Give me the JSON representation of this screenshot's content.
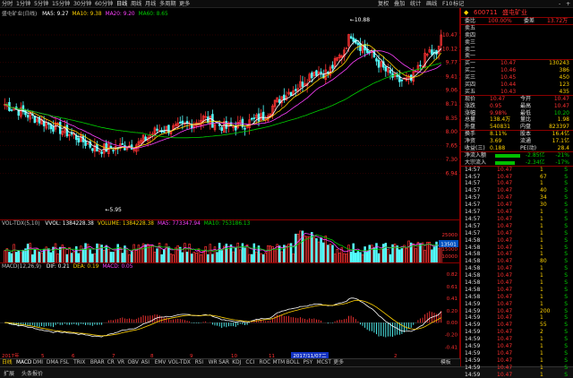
{
  "toolbar": {
    "items": [
      "分时",
      "1分钟",
      "5分钟",
      "15分钟",
      "30分钟",
      "60分钟",
      "日线",
      "周线",
      "月线",
      "多周期",
      "更多"
    ],
    "active_index": 6,
    "right_items": [
      "复权",
      "叠加",
      "统计",
      "画线",
      "F10",
      "标记",
      "-",
      "+"
    ]
  },
  "main": {
    "title": "盛屯矿业(日线)",
    "ma_legend": [
      {
        "label": "MA5: 9.27",
        "color": "#ffffff"
      },
      {
        "label": "MA10: 9.38",
        "color": "#ffd200"
      },
      {
        "label": "MA20: 9.20",
        "color": "#ff40ff"
      },
      {
        "label": "MA60: 8.65",
        "color": "#00d000"
      }
    ],
    "y_labels": [
      "10.47",
      "10.12",
      "9.77",
      "9.41",
      "9.06",
      "8.71",
      "8.35",
      "8.00",
      "7.65",
      "7.30",
      "6.94"
    ],
    "high_label": "10.88",
    "low_label": "5.95"
  },
  "volume": {
    "title": "VOL-TDX(5,10)",
    "legend": [
      {
        "label": "VVOL: 1384228.38",
        "color": "#ffffff"
      },
      {
        "label": "VOLUME: 1384228.38",
        "color": "#ffd200"
      },
      {
        "label": "MA5: 773347.94",
        "color": "#ff40ff"
      },
      {
        "label": "MA10: 753186.13",
        "color": "#00d000"
      }
    ],
    "y_labels": [
      "25000",
      "20000",
      "15000",
      "10000"
    ],
    "unit": "x100",
    "marker": "13501"
  },
  "macd": {
    "title": "MACD(12,26,9)",
    "legend": [
      {
        "label": "DIF: 0.21",
        "color": "#ffffff"
      },
      {
        "label": "DEA: 0.19",
        "color": "#ffd200"
      },
      {
        "label": "MACD: 0.05",
        "color": "#ff40ff"
      }
    ],
    "y_labels": [
      "0.82",
      "0.61",
      "0.41",
      "0.20",
      "0.00",
      "-0.20",
      "-0.41"
    ],
    "date_labels": [
      "2017年",
      "5",
      "6",
      "7",
      "8",
      "9",
      "10",
      "11",
      "12",
      "2"
    ],
    "date_cursor": "2017/11/07二"
  },
  "bottom_tabs": {
    "items": [
      "MACD",
      "DMI",
      "DMA",
      "FSL",
      "TRIX",
      "BRAR",
      "CR",
      "VR",
      "OBV",
      "ASI",
      "EMV",
      "VOL-TDX",
      "RSI",
      "WR",
      "SAR",
      "KDJ",
      "CCI",
      "ROC",
      "MTM",
      "BOLL",
      "PSY",
      "MCST",
      "更多"
    ],
    "prefix": "日线",
    "suffix": "模板"
  },
  "statusbar": {
    "left": "扩展",
    "mid": "头条报价"
  },
  "quote": {
    "code": "600711",
    "name": "盛屯矿业",
    "wb_label": "委比",
    "wb_value": "100.00%",
    "wc_label": "委差",
    "wc_value": "13.72万",
    "asks": [
      {
        "label": "卖五",
        "price": "",
        "vol": ""
      },
      {
        "label": "卖四",
        "price": "",
        "vol": ""
      },
      {
        "label": "卖三",
        "price": "",
        "vol": ""
      },
      {
        "label": "卖二",
        "price": "",
        "vol": ""
      },
      {
        "label": "卖一",
        "price": "",
        "vol": ""
      }
    ],
    "bids": [
      {
        "label": "买一",
        "price": "10.47",
        "vol": "130243"
      },
      {
        "label": "买二",
        "price": "10.46",
        "vol": "386"
      },
      {
        "label": "买三",
        "price": "10.45",
        "vol": "450"
      },
      {
        "label": "买四",
        "price": "10.44",
        "vol": "123"
      },
      {
        "label": "买五",
        "price": "10.43",
        "vol": "435"
      }
    ],
    "stats": [
      {
        "l1": "现价",
        "v1": "10.47",
        "l2": "今开",
        "v2": "10.47"
      },
      {
        "l1": "涨跌",
        "v1": "0.95",
        "l2": "最高",
        "v2": "10.47"
      },
      {
        "l1": "涨幅",
        "v1": "9.98%",
        "l2": "最低",
        "v2": "10.20"
      },
      {
        "l1": "总量",
        "v1": "138.4万",
        "l2": "量比",
        "v2": "1.98"
      },
      {
        "l1": "外盘",
        "v1": "540831",
        "l2": "内盘",
        "v2": "823397"
      }
    ],
    "stats2": [
      {
        "l1": "换手",
        "v1": "8.11%",
        "l2": "股本",
        "v2": "16.4亿"
      },
      {
        "l1": "净资",
        "v1": "3.69",
        "l2": "流通",
        "v2": "17.1亿"
      },
      {
        "l1": "收益(三)",
        "v1": "0.188",
        "l2": "PE(动)",
        "v2": "28.4"
      }
    ],
    "flows": [
      {
        "label": "净流入额",
        "value": "-2.85亿",
        "pct": "-21%"
      },
      {
        "label": "大宗流入",
        "value": "-2.34亿",
        "pct": "-17%"
      }
    ],
    "ticks": [
      {
        "t": "14:57",
        "p": "10.47",
        "v": "1",
        "s": "S"
      },
      {
        "t": "14:57",
        "p": "10.47",
        "v": "67",
        "s": "S"
      },
      {
        "t": "14:57",
        "p": "10.47",
        "v": "1",
        "s": "S"
      },
      {
        "t": "14:57",
        "p": "10.47",
        "v": "40",
        "s": "S"
      },
      {
        "t": "14:57",
        "p": "10.47",
        "v": "34",
        "s": "S"
      },
      {
        "t": "14:57",
        "p": "10.47",
        "v": "30",
        "s": "S"
      },
      {
        "t": "14:57",
        "p": "10.47",
        "v": "1",
        "s": "S"
      },
      {
        "t": "14:57",
        "p": "10.47",
        "v": "1",
        "s": "S"
      },
      {
        "t": "14:57",
        "p": "10.47",
        "v": "1",
        "s": "S"
      },
      {
        "t": "14:57",
        "p": "10.47",
        "v": "1",
        "s": "S"
      },
      {
        "t": "14:58",
        "p": "10.47",
        "v": "1",
        "s": "S"
      },
      {
        "t": "14:58",
        "p": "10.47",
        "v": "1",
        "s": "S"
      },
      {
        "t": "14:58",
        "p": "10.47",
        "v": "1",
        "s": "S"
      },
      {
        "t": "14:58",
        "p": "10.47",
        "v": "80",
        "s": "S"
      },
      {
        "t": "14:58",
        "p": "10.47",
        "v": "1",
        "s": "S"
      },
      {
        "t": "14:58",
        "p": "10.47",
        "v": "1",
        "s": "S"
      },
      {
        "t": "14:58",
        "p": "10.47",
        "v": "1",
        "s": "S"
      },
      {
        "t": "14:58",
        "p": "10.47",
        "v": "1",
        "s": "S"
      },
      {
        "t": "14:58",
        "p": "10.47",
        "v": "1",
        "s": "S"
      },
      {
        "t": "14:59",
        "p": "10.47",
        "v": "1",
        "s": "S"
      },
      {
        "t": "14:59",
        "p": "10.47",
        "v": "200",
        "s": "S"
      },
      {
        "t": "14:59",
        "p": "10.47",
        "v": "1",
        "s": "S"
      },
      {
        "t": "14:59",
        "p": "10.47",
        "v": "55",
        "s": "S"
      },
      {
        "t": "14:59",
        "p": "10.47",
        "v": "2",
        "s": "S"
      },
      {
        "t": "14:59",
        "p": "10.47",
        "v": "1",
        "s": "S"
      },
      {
        "t": "14:59",
        "p": "10.47",
        "v": "1",
        "s": "S"
      },
      {
        "t": "14:59",
        "p": "10.47",
        "v": "1",
        "s": "S"
      },
      {
        "t": "14:59",
        "p": "10.47",
        "v": "1",
        "s": "S"
      },
      {
        "t": "14:59",
        "p": "10.47",
        "v": "1",
        "s": "S"
      },
      {
        "t": "14:59",
        "p": "10.47",
        "v": "1",
        "s": "S"
      }
    ]
  }
}
